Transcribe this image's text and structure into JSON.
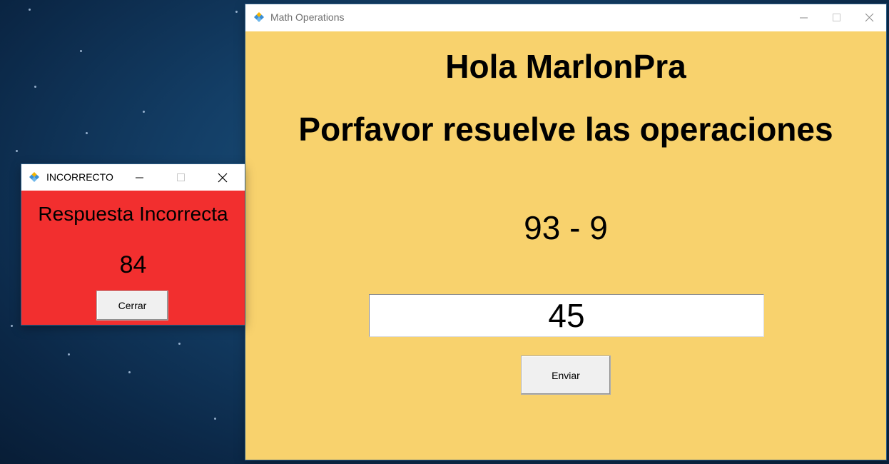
{
  "main_window": {
    "title": "Math Operations",
    "greeting": "Hola MarlonPra",
    "instruction": "Porfavor resuelve las operaciones",
    "operation": "93 - 9",
    "answer_value": "45",
    "send_label": "Enviar"
  },
  "dialog": {
    "title": "INCORRECTO",
    "message": "Respuesta Incorrecta",
    "correct_value": "84",
    "close_label": "Cerrar"
  },
  "colors": {
    "main_background": "#f8d26d",
    "dialog_background": "#f22f2f",
    "desktop": "#133e66"
  },
  "icons": [
    "app-icon",
    "minimize-icon",
    "maximize-icon",
    "close-icon"
  ]
}
